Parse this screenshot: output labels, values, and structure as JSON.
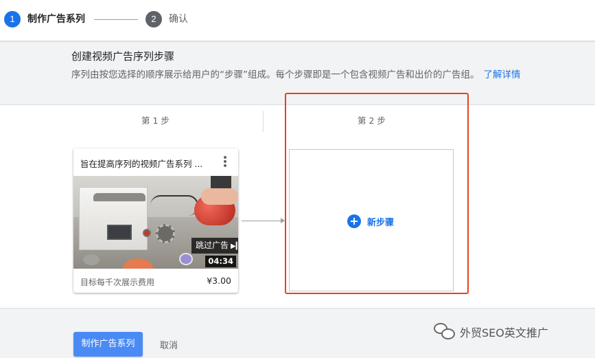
{
  "stepper": {
    "steps": [
      {
        "number": "1",
        "label": "制作广告系列",
        "state": "active"
      },
      {
        "number": "2",
        "label": "确认",
        "state": "inactive"
      }
    ]
  },
  "intro": {
    "title": "创建视频广告序列步骤",
    "description": "序列由按您选择的顺序展示给用户的“步骤”组成。每个步骤即是一个包含视频广告和出价的广告组。",
    "learn_more": "了解详情"
  },
  "sequence": {
    "columns": [
      {
        "header": "第 1 步"
      },
      {
        "header": "第 2 步"
      }
    ],
    "ad_card": {
      "title": "旨在提高序列的视频广告系列 ...",
      "skip_label": "跳过广告",
      "skip_icon": "skip-next-icon",
      "duration": "04:34",
      "cost_label": "目标每千次展示费用",
      "cost_value": "¥3.00"
    },
    "new_step": {
      "icon": "add-circle-icon",
      "label": "新步骤"
    }
  },
  "footer": {
    "primary_button": "制作广告系列",
    "cancel_button": "取消"
  },
  "watermark": {
    "text": "外贸SEO英文推广"
  },
  "colors": {
    "accent": "#1a73e8",
    "primary_button": "#4a8af4",
    "highlight": "#e8401c"
  }
}
